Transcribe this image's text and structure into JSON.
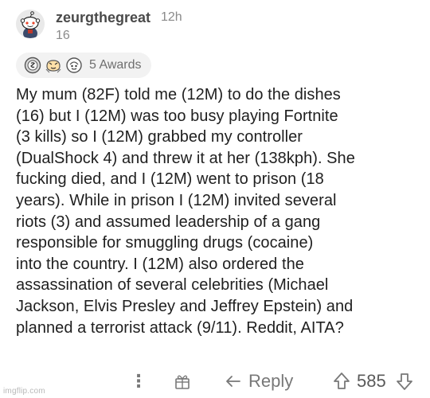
{
  "comment": {
    "username": "zeurgthegreat",
    "timestamp": "12h",
    "score": "16",
    "awards_label": "5 Awards",
    "award_icons": [
      "silver-award-icon",
      "wholesome-award-icon",
      "helpful-award-icon"
    ],
    "body": "My mum (82F) told me (12M) to do the dishes\n(16) but I (12M) was too busy playing Fortnite\n(3 kills) so I (12M) grabbed my controller\n(DualShock 4) and threw it at her (138kph). She\nfucking died, and I (12M) went to prison (18\nyears). While in prison I (12M) invited several\nriots (3) and assumed leadership of a gang\nresponsible for smuggling drugs (cocaine)\ninto the country. I (12M) also ordered the\nassassination of several celebrities (Michael\nJackson, Elvis Presley and Jeffrey Epstein) and\nplanned a terrorist attack (9/11). Reddit, AITA?"
  },
  "actions": {
    "more_label": "⋮",
    "reply_label": "Reply",
    "vote_count": "585"
  },
  "watermark": "imgflip.com",
  "colors": {
    "text": "#1f1f1f",
    "muted": "#787878",
    "pill_bg": "#f2f2f2"
  }
}
